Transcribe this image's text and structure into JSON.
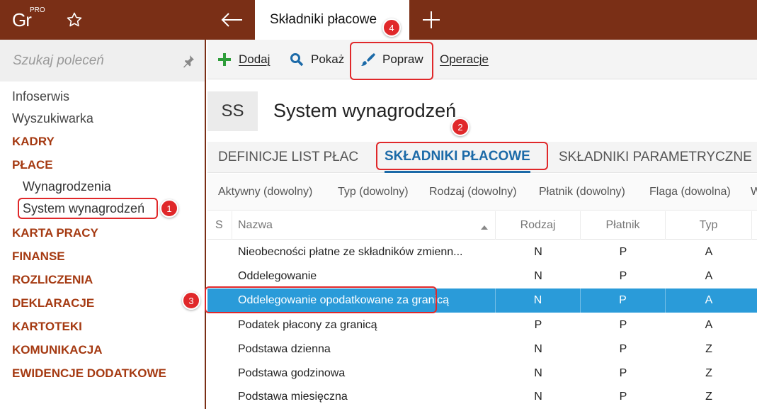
{
  "app": {
    "logo_text": "Gr",
    "logo_badge": "PRO",
    "active_tab": "Składniki płacowe"
  },
  "sidebar": {
    "search_placeholder": "Szukaj poleceń",
    "items": [
      {
        "label": "Infoserwis",
        "kind": "plain"
      },
      {
        "label": "Wyszukiwarka",
        "kind": "plain"
      },
      {
        "label": "KADRY",
        "kind": "section"
      },
      {
        "label": "PŁACE",
        "kind": "section"
      },
      {
        "label": "Wynagrodzenia",
        "kind": "sub"
      },
      {
        "label": "System wynagrodzeń",
        "kind": "sub"
      },
      {
        "label": "KARTA PRACY",
        "kind": "section"
      },
      {
        "label": "FINANSE",
        "kind": "section"
      },
      {
        "label": "ROZLICZENIA",
        "kind": "section"
      },
      {
        "label": "DEKLARACJE",
        "kind": "section"
      },
      {
        "label": "KARTOTEKI",
        "kind": "section"
      },
      {
        "label": "KOMUNIKACJA",
        "kind": "section"
      },
      {
        "label": "EWIDENCJE DODATKOWE",
        "kind": "section"
      }
    ]
  },
  "toolbar": {
    "add_label": "Dodaj",
    "show_label": "Pokaż",
    "edit_label": "Popraw",
    "operations_label": "Operacje"
  },
  "module": {
    "badge": "SS",
    "title": "System wynagrodzeń"
  },
  "tabs": [
    {
      "label": "DEFINICJE LIST PŁAC"
    },
    {
      "label": "SKŁADNIKI PŁACOWE"
    },
    {
      "label": "SKŁADNIKI PARAMETRYCZNE"
    }
  ],
  "filters": [
    {
      "label": "Aktywny (dowolny)"
    },
    {
      "label": "Typ (dowolny)"
    },
    {
      "label": "Rodzaj (dowolny)"
    },
    {
      "label": "Płatnik (dowolny)"
    },
    {
      "label": "Flaga (dowolna)"
    },
    {
      "label": "W"
    }
  ],
  "grid": {
    "columns": {
      "s": "S",
      "nazwa": "Nazwa",
      "rodzaj": "Rodzaj",
      "platnik": "Płatnik",
      "typ": "Typ"
    },
    "rows": [
      {
        "nazwa": "Nieobecności płatne ze składników zmienn...",
        "rodzaj": "N",
        "platnik": "P",
        "typ": "A"
      },
      {
        "nazwa": "Oddelegowanie",
        "rodzaj": "N",
        "platnik": "P",
        "typ": "A"
      },
      {
        "nazwa": "Oddelegowanie opodatkowane za granicą",
        "rodzaj": "N",
        "platnik": "P",
        "typ": "A"
      },
      {
        "nazwa": "Podatek płacony za granicą",
        "rodzaj": "P",
        "platnik": "P",
        "typ": "A"
      },
      {
        "nazwa": "Podstawa dzienna",
        "rodzaj": "N",
        "platnik": "P",
        "typ": "Z"
      },
      {
        "nazwa": "Podstawa godzinowa",
        "rodzaj": "N",
        "platnik": "P",
        "typ": "Z"
      },
      {
        "nazwa": "Podstawa miesięczna",
        "rodzaj": "N",
        "platnik": "P",
        "typ": "Z"
      }
    ]
  },
  "markers": {
    "m1": "1",
    "m2": "2",
    "m3": "3",
    "m4": "4"
  },
  "colors": {
    "topbar": "#7a2f16",
    "section_text": "#a53a12",
    "selection": "#2a9bd9",
    "active_tab": "#1c6aa8",
    "annotation": "#e0282a",
    "add_icon": "#2e9d3a",
    "search_icon": "#1c6aa8"
  }
}
